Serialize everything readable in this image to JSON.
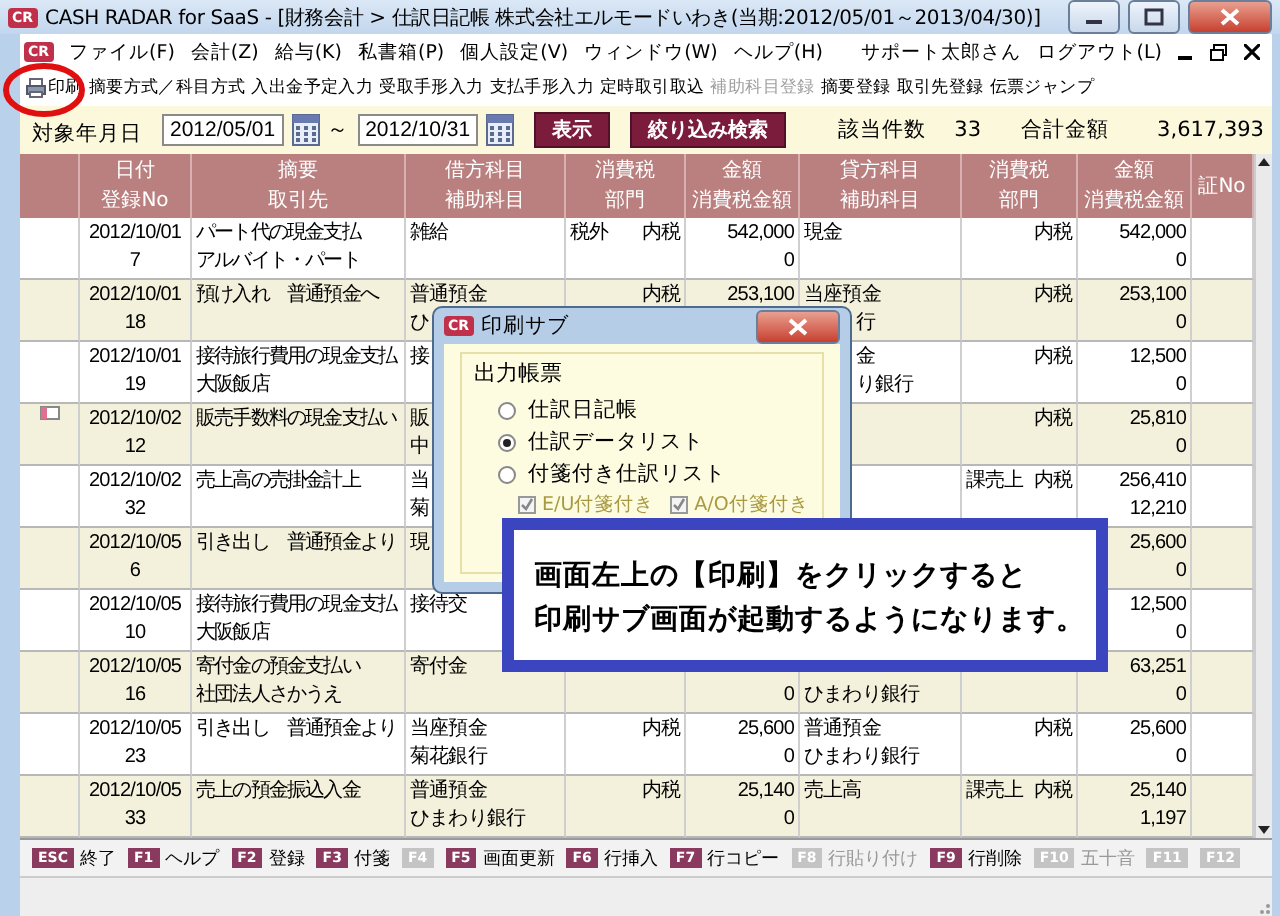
{
  "window": {
    "logo": "CR",
    "title": "CASH RADAR for SaaS - [財務会計 > 仕訳日記帳 株式会社エルモードいわき(当期:2012/05/01～2013/04/30)]"
  },
  "menu": {
    "logo": "CR",
    "items": [
      "ファイル(F)",
      "会計(Z)",
      "給与(K)",
      "私書箱(P)",
      "個人設定(V)",
      "ウィンドウ(W)",
      "ヘルプ(H)"
    ],
    "user": "サポート太郎さん",
    "logout": "ログアウト(L)"
  },
  "toolbar": [
    {
      "label": "印刷",
      "disabled": false,
      "kind": "print"
    },
    {
      "label": "摘要方式／科目方式",
      "disabled": false,
      "kind": "text"
    },
    {
      "label": "入出金予定入力",
      "disabled": false,
      "kind": "text"
    },
    {
      "label": "受取手形入力",
      "disabled": false,
      "kind": "text"
    },
    {
      "label": "支払手形入力",
      "disabled": false,
      "kind": "text"
    },
    {
      "label": "定時取引取込",
      "disabled": false,
      "kind": "text"
    },
    {
      "label": "補助科目登録",
      "disabled": true,
      "kind": "text"
    },
    {
      "label": "摘要登録",
      "disabled": false,
      "kind": "text"
    },
    {
      "label": "取引先登録",
      "disabled": false,
      "kind": "text"
    },
    {
      "label": "伝票ジャンプ",
      "disabled": false,
      "kind": "text"
    }
  ],
  "filter": {
    "label": "対象年月日",
    "from": "2012/05/01",
    "separator": "～",
    "to": "2012/10/31",
    "show_button": "表示",
    "search_button": "絞り込み検索",
    "count_label": "該当件数",
    "count": "33",
    "total_label": "合計金額",
    "total": "3,617,393"
  },
  "columns": [
    [
      "日付",
      "登録No"
    ],
    [
      "摘要",
      "取引先"
    ],
    [
      "借方科目",
      "補助科目"
    ],
    [
      "消費税",
      "部門"
    ],
    [
      "金額",
      "消費税金額"
    ],
    [
      "貸方科目",
      "補助科目"
    ],
    [
      "消費税",
      "部門"
    ],
    [
      "金額",
      "消費税金額"
    ],
    [
      "証No"
    ]
  ],
  "rows": [
    {
      "memo": false,
      "date": "2012/10/01",
      "no": "7",
      "summary": "パート代の現金支払",
      "partner": "アルバイト・パート",
      "debit": "雑給",
      "tax_class": "税外",
      "tax": "内税",
      "amount": "542,000",
      "tax_amount": "0",
      "credit": "現金",
      "tax2": "内税",
      "amount2": "542,000",
      "tax_amount2": "0"
    },
    {
      "memo": false,
      "date": "2012/10/01",
      "no": "18",
      "summary": "預け入れ　普通預金へ",
      "debit": "普通預金",
      "debit_sub": "ひ",
      "tax": "内税",
      "amount": "253,100",
      "credit": "当座預金",
      "credit_sub": {
        "text": "行",
        "covered": true
      },
      "tax2": "内税",
      "amount2": "253,100",
      "tax_amount2": "0"
    },
    {
      "memo": false,
      "date": "2012/10/01",
      "no": "19",
      "summary": "接待旅行費用の現金支払",
      "partner": "大阪飯店",
      "debit": "接",
      "credit": {
        "text": "金",
        "covered": true
      },
      "credit_sub": {
        "text": "り銀行",
        "covered": true
      },
      "tax2": "内税",
      "amount2": "12,500",
      "tax_amount2": "0"
    },
    {
      "memo": true,
      "date": "2012/10/02",
      "no": "12",
      "summary": "販売手数料の現金支払い",
      "debit": "販",
      "debit_sub": "中",
      "tax2": "内税",
      "amount2": "25,810",
      "tax_amount2": "0"
    },
    {
      "memo": false,
      "date": "2012/10/02",
      "no": "32",
      "summary": "売上高の売掛金計上",
      "debit": "当",
      "debit_sub": "菊",
      "tax2_class": "課売上",
      "tax2": "内税",
      "amount2": "256,410",
      "tax_amount2": "12,210"
    },
    {
      "memo": false,
      "date": "2012/10/05",
      "no": "6",
      "summary": "引き出し　普通預金より",
      "debit": "現",
      "amount2": "25,600",
      "tax_amount2": "0"
    },
    {
      "memo": false,
      "date": "2012/10/05",
      "no": "10",
      "summary": "接待旅行費用の現金支払",
      "partner": "大阪飯店",
      "debit": "接待交",
      "amount2": "12,500",
      "tax_amount2": "0"
    },
    {
      "memo": false,
      "date": "2012/10/05",
      "no": "16",
      "summary": "寄付金の預金支払い",
      "partner": "社団法人さかうえ",
      "debit": "寄付金",
      "tax_amount": "0",
      "credit_sub": "ひまわり銀行",
      "amount2": "63,251",
      "tax_amount2": "0"
    },
    {
      "memo": false,
      "date": "2012/10/05",
      "no": "23",
      "summary": "引き出し　普通預金より",
      "debit": "当座預金",
      "debit_sub": "菊花銀行",
      "tax": "内税",
      "amount": "25,600",
      "tax_amount": "0",
      "credit": "普通預金",
      "credit_sub": "ひまわり銀行",
      "tax2": "内税",
      "amount2": "25,600",
      "tax_amount2": "0"
    },
    {
      "memo": false,
      "date": "2012/10/05",
      "no": "33",
      "summary": "売上の預金振込入金",
      "debit": "普通預金",
      "debit_sub": "ひまわり銀行",
      "tax": "内税",
      "amount": "25,140",
      "tax_amount": "0",
      "credit": "売上高",
      "tax2_class": "課売上",
      "tax2": "内税",
      "amount2": "25,140",
      "tax_amount2": "1,197"
    }
  ],
  "function_keys": [
    {
      "key": "ESC",
      "label": "終了",
      "disabled": false
    },
    {
      "key": "F1",
      "label": "ヘルプ",
      "disabled": false
    },
    {
      "key": "F2",
      "label": "登録",
      "disabled": false
    },
    {
      "key": "F3",
      "label": "付箋",
      "disabled": false
    },
    {
      "key": "F4",
      "disabled": true
    },
    {
      "key": "F5",
      "label": "画面更新",
      "disabled": false
    },
    {
      "key": "F6",
      "label": "行挿入",
      "disabled": false
    },
    {
      "key": "F7",
      "label": "行コピー",
      "disabled": false
    },
    {
      "key": "F8",
      "label": "行貼り付け",
      "disabled": true
    },
    {
      "key": "F9",
      "label": "行削除",
      "disabled": false
    },
    {
      "key": "F10",
      "label": "五十音",
      "disabled": true
    },
    {
      "key": "F11",
      "disabled": true
    },
    {
      "key": "F12",
      "disabled": true
    }
  ],
  "dialog": {
    "logo": "CR",
    "title": "印刷サブ",
    "group": "出力帳票",
    "options": [
      {
        "label": "仕訳日記帳",
        "selected": false
      },
      {
        "label": "仕訳データリスト",
        "selected": true
      },
      {
        "label": "付箋付き仕訳リスト",
        "selected": false
      }
    ],
    "checkboxes": [
      {
        "label": "E/U付箋付き",
        "checked": true,
        "disabled": true
      },
      {
        "label": "A/O付箋付き",
        "checked": true,
        "disabled": true
      }
    ]
  },
  "callout": {
    "lines": [
      "画面左上の【印刷】をクリックすると",
      "印刷サブ画面が起動するようになります。"
    ]
  }
}
